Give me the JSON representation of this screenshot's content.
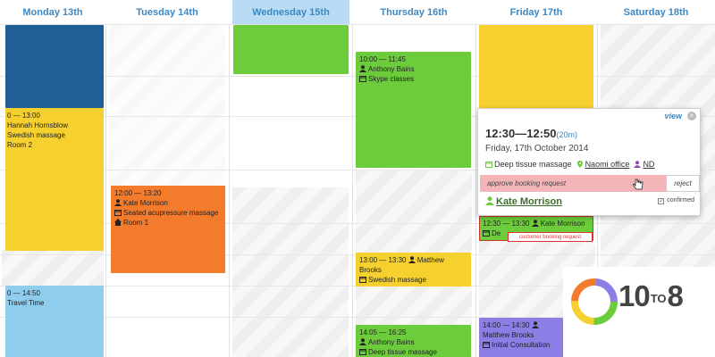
{
  "days": [
    {
      "label": "Monday 13th"
    },
    {
      "label": "Tuesday 14th"
    },
    {
      "label": "Wednesday 15th"
    },
    {
      "label": "Thursday 16th"
    },
    {
      "label": "Friday 17th"
    },
    {
      "label": "Saturday 18th"
    }
  ],
  "events": {
    "mon_massage": {
      "time": "0 — 13:00",
      "name": "Hannah Hornsblow",
      "service": "Swedish massage",
      "room": "Room 2"
    },
    "mon_travel": {
      "time": "0 — 14:50",
      "service": "Travel Time"
    },
    "tue_acu": {
      "time": "12:00 — 13:20",
      "name": "Kate Morrison",
      "service": "Seated acupressure massage",
      "room": "Room 1"
    },
    "thu_skype": {
      "time": "10:00 — 11:45",
      "name": "Anthony Bains",
      "service": "Skype classes"
    },
    "thu_swedish": {
      "time": "13:00 — 13:30",
      "name": "Matthew Brooks",
      "service": "Swedish massage"
    },
    "thu_deep": {
      "time": "14:05 — 16:25",
      "name": "Anthony Bains",
      "service": "Deep tissue massage"
    },
    "fri_kate": {
      "time": "12:30 — 13:30",
      "name": "Kate Morrison",
      "service": "De"
    },
    "fri_consult": {
      "time": "14:00 — 14:30",
      "name": "Matthew Brooks",
      "service": "Initial Consultation"
    }
  },
  "popup": {
    "view_label": "view",
    "close_glyph": "×",
    "time": "12:30—12:50",
    "duration": "(20m)",
    "date": "Friday, 17th October 2014",
    "service": "Deep tissue massage",
    "location": "Naomi office",
    "staff": "ND",
    "approve_label": "approve booking request",
    "reject_label": "reject",
    "client": "Kate Morrison",
    "confirmed_label": "confirmed"
  },
  "tooltip": "customer booking request",
  "logo": {
    "left": "10",
    "middle": "TO",
    "right": "8"
  },
  "colors": {
    "header_text": "#3b88c4",
    "today_header": "#b9dcf4",
    "blue_event": "#1f5e96",
    "yellow_event": "#f6d02f",
    "orange_event": "#f27b2c",
    "green_event": "#6ccc3b",
    "light_blue_event": "#8fcdef",
    "purple_event": "#8b7fe6",
    "approve_bg": "#f3b5b7"
  },
  "icons": [
    "person-icon",
    "calendar-icon",
    "home-icon",
    "location-icon",
    "close-icon",
    "checkbox-icon",
    "cursor-icon",
    "logo-ring-icon"
  ]
}
